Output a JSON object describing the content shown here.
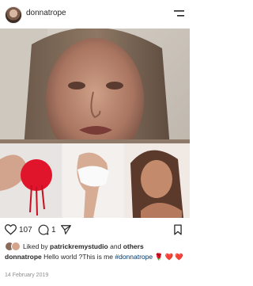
{
  "header": {
    "username": "donnatrope"
  },
  "actions": {
    "like_count": "107",
    "comment_count": "1"
  },
  "liked_by": {
    "prefix": "Liked by",
    "user": "patrickremystudio",
    "conj": "and",
    "others": "others"
  },
  "caption": {
    "username": "donnatrope",
    "text": "Hello world ?This is me",
    "hashtag": "#donnatrope",
    "emoji": "🌹 ❤️ ❤️"
  },
  "date": "14 February 2019",
  "icons": {
    "menu": "menu-icon",
    "like": "heart-outline-icon",
    "comment": "comment-icon",
    "share": "send-icon",
    "save": "bookmark-icon",
    "emoji_heart": "red-heart",
    "emoji_rose": "rose"
  },
  "colors": {
    "heart_red": "#e0142b",
    "link": "#00376b",
    "muted": "#8e8e8e"
  }
}
